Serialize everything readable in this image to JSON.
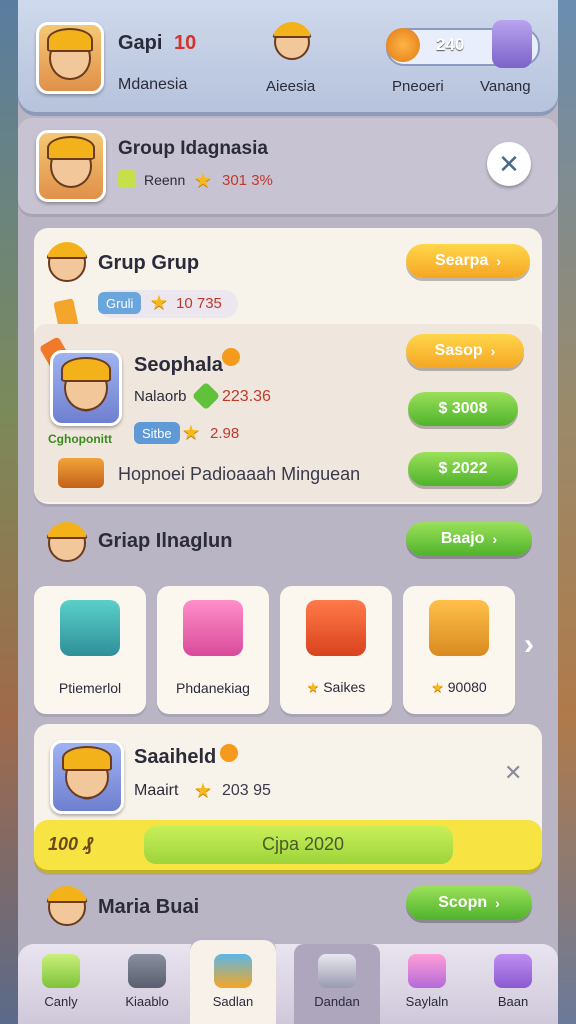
{
  "header": {
    "player_name": "Gapi",
    "player_level": "10",
    "player_region": "Mdanesia",
    "center_label": "Aieesia",
    "right_label_1": "Pneoeri",
    "right_label_2": "Vanang",
    "currency_value": "240"
  },
  "group_header": {
    "title": "Group Idagnasia",
    "sub_label": "Reenn",
    "score": "301 3%"
  },
  "group_card": {
    "title": "Grup Grup",
    "button_label": "Searpa",
    "tag_label": "Gruli",
    "points": "10 735"
  },
  "member": {
    "name": "Seophala",
    "label1": "Nalaorb",
    "value1": "223.36",
    "tag_label": "Sitbe",
    "value2": "2.98",
    "caption": "Cghoponitt",
    "footer": "Hopnoei Padioaaah Minguean",
    "btn_top": "Sasop",
    "btn_mid": "$ 3008",
    "btn_bottom": "$ 2022"
  },
  "section": {
    "title": "Griap Ilnaglun",
    "button_label": "Baajo"
  },
  "tiles": [
    {
      "label": "Ptiemerlol"
    },
    {
      "label": "Phdanekiag"
    },
    {
      "label": "Saikes"
    },
    {
      "label": "90080"
    }
  ],
  "saved": {
    "name": "Saaiheld",
    "label": "Maairt",
    "value": "203 95",
    "progress_left": "100 ₰",
    "progress_text": "Cjpa 2020",
    "progress_fraction": 0.8
  },
  "footer_row": {
    "name": "Maria Buai",
    "button_label": "Scopn"
  },
  "nav": [
    {
      "label": "Canly"
    },
    {
      "label": "Kiaablo"
    },
    {
      "label": "Sadlan"
    },
    {
      "label": "Dandan"
    },
    {
      "label": "Saylaln"
    },
    {
      "label": "Baan"
    }
  ],
  "colors": {
    "accent_orange": "#f5a623",
    "accent_green": "#4fb32b",
    "progress_yellow": "#f7e442"
  }
}
